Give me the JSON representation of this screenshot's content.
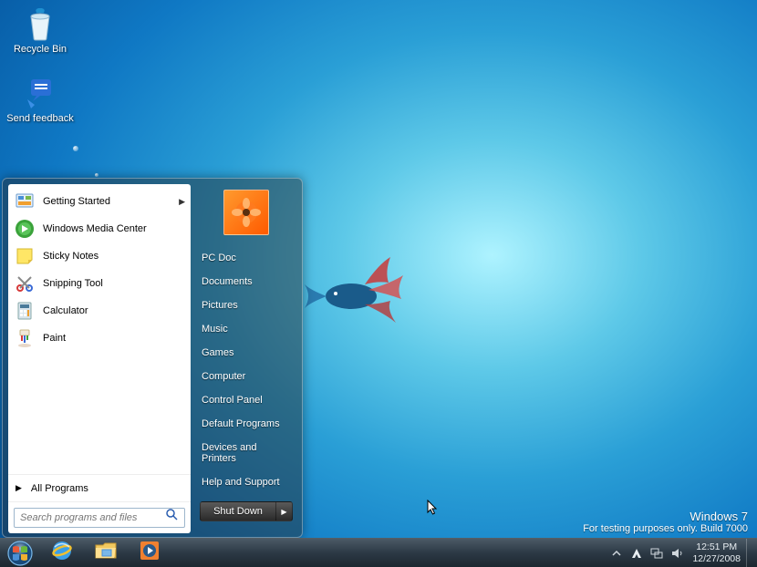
{
  "desktop_icons": [
    {
      "name": "recycle-bin",
      "label": "Recycle Bin"
    },
    {
      "name": "send-feedback",
      "label": "Send feedback"
    }
  ],
  "start_menu": {
    "programs": [
      {
        "name": "getting-started",
        "label": "Getting Started",
        "has_submenu": true
      },
      {
        "name": "windows-media-center",
        "label": "Windows Media Center",
        "has_submenu": false
      },
      {
        "name": "sticky-notes",
        "label": "Sticky Notes",
        "has_submenu": false
      },
      {
        "name": "snipping-tool",
        "label": "Snipping Tool",
        "has_submenu": false
      },
      {
        "name": "calculator",
        "label": "Calculator",
        "has_submenu": false
      },
      {
        "name": "paint",
        "label": "Paint",
        "has_submenu": false
      }
    ],
    "all_programs_label": "All Programs",
    "search_placeholder": "Search programs and files",
    "right_links": [
      "PC Doc",
      "Documents",
      "Pictures",
      "Music",
      "Games",
      "Computer",
      "Control Panel",
      "Default Programs",
      "Devices and Printers",
      "Help and Support"
    ],
    "shutdown_label": "Shut Down"
  },
  "watermark": {
    "line1": "Windows  7",
    "line2": "For testing purposes only. Build 7000"
  },
  "clock": {
    "time": "12:51 PM",
    "date": "12/27/2008"
  }
}
